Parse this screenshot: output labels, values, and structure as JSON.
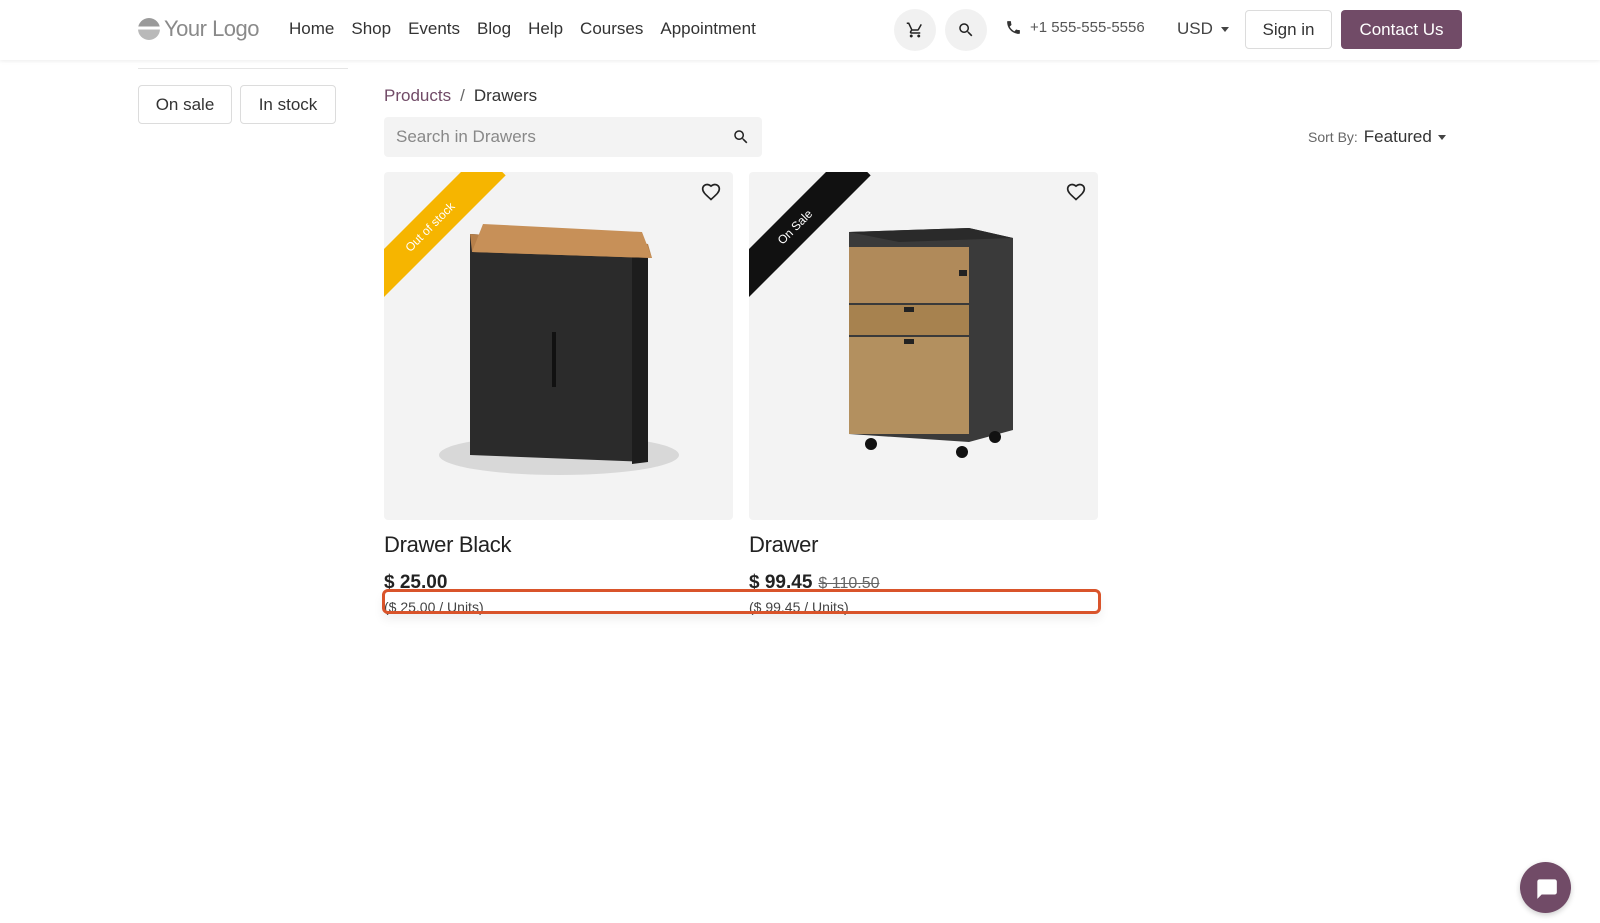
{
  "header": {
    "logo_text": "Your Logo",
    "nav": [
      "Home",
      "Shop",
      "Events",
      "Blog",
      "Help",
      "Courses",
      "Appointment"
    ],
    "phone": "+1 555-555-5556",
    "currency": "USD",
    "sign_in": "Sign in",
    "contact": "Contact Us"
  },
  "filters": {
    "on_sale": "On sale",
    "in_stock": "In stock"
  },
  "breadcrumb": {
    "parent": "Products",
    "separator": "/",
    "current": "Drawers"
  },
  "search": {
    "placeholder": "Search in Drawers"
  },
  "sort": {
    "label": "Sort By:",
    "value": "Featured"
  },
  "products": [
    {
      "ribbon": "Out of stock",
      "name": "Drawer Black",
      "price": "$ 25.00",
      "old_price": "",
      "unit_price": "($ 25.00 / Units)"
    },
    {
      "ribbon": "On Sale",
      "name": "Drawer",
      "price": "$ 99.45",
      "old_price": "$ 110.50",
      "unit_price": "($ 99.45 / Units)"
    }
  ],
  "colors": {
    "brand": "#714b67",
    "highlight": "#d9542b",
    "ribbon_out": "#f6b500",
    "ribbon_sale": "#111111"
  },
  "icons": [
    "cart-icon",
    "search-icon",
    "phone-icon",
    "heart-icon",
    "chat-icon"
  ]
}
